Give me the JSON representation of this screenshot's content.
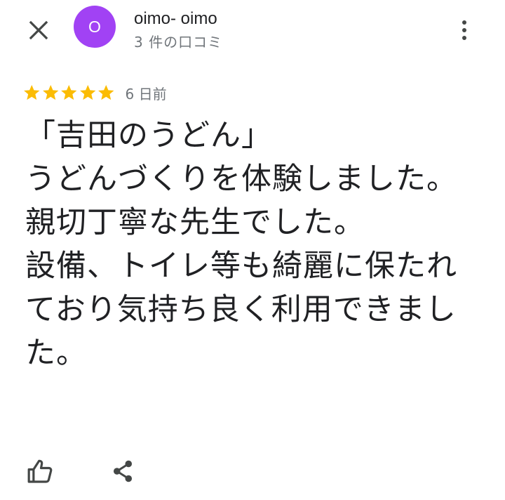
{
  "header": {
    "close_icon": "close-icon",
    "avatar_letter": "O",
    "avatar_color": "#a142f4",
    "user_name": "oimo- oimo",
    "review_count": "3 件の口コミ",
    "more_icon": "more-vert-icon"
  },
  "rating": {
    "stars": 5,
    "max_stars": 5,
    "star_color": "#fbbc04",
    "date": "6 日前"
  },
  "review": {
    "text": "「吉田のうどん」\nうどんづくりを体験しました。\n親切丁寧な先生でした。\n設備、トイレ等も綺麗に保たれており気持ち良く利用できました。"
  },
  "actions": {
    "like_icon": "thumb-up-icon",
    "share_icon": "share-icon"
  },
  "colors": {
    "text_primary": "#202124",
    "text_secondary": "#70757a",
    "icon": "#444746",
    "background": "#ffffff"
  }
}
